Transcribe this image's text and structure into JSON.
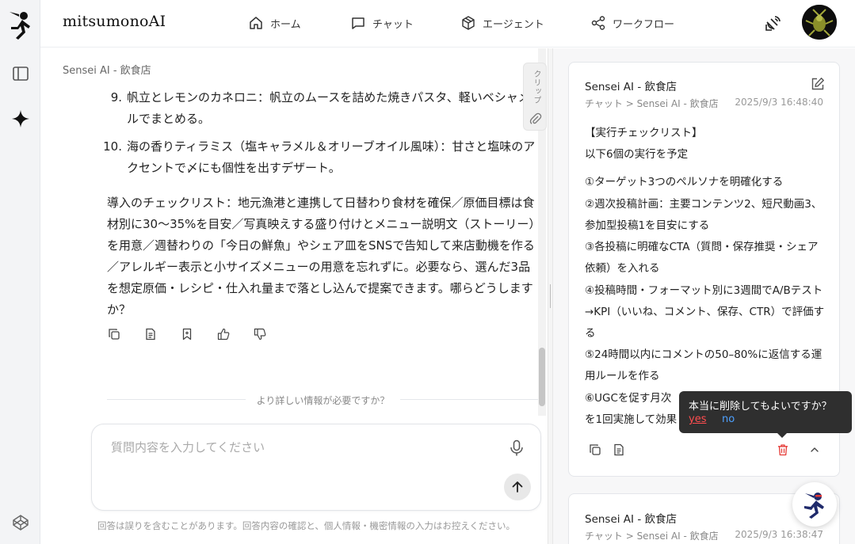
{
  "app": {
    "brand": "mitsumonoAI"
  },
  "nav": {
    "home": "ホーム",
    "chat": "チャット",
    "agent": "エージェント",
    "workflow": "ワークフロー"
  },
  "chat": {
    "breadcrumb": "Sensei AI - 飲食店",
    "list_items": [
      {
        "num": "9.",
        "text": "帆立とレモンのカネロニ：帆立のムースを詰めた焼きパスタ、軽いベシャメルでまとめる。"
      },
      {
        "num": "10.",
        "text": "海の香りティラミス（塩キャラメル＆オリーブオイル風味）：甘さと塩味のアクセントで〆にも個性を出すデザート。"
      }
    ],
    "paragraph": "導入のチェックリスト：地元漁港と連携して日替わり食材を確保／原価目標は食材別に30〜35%を目安／写真映えする盛り付けとメニュー説明文（ストーリー）を用意／週替わりの「今日の鮮魚」やシェア皿をSNSで告知して来店動機を作る／アレルギー表示と小サイズメニューの用意を忘れずに。必要なら、選んだ3品を想定原価・レシピ・仕入れ量まで落とし込んで提案できます。哪らどうしますか？",
    "divider_label": "より詳しい情報が必要ですか？",
    "input_placeholder": "質問内容を入力してください",
    "disclaimer": "回答は誤りを含むことがあります。回答内容の確認と、個人情報・機密情報の入力はお控えください。",
    "clip_label": "クリップ"
  },
  "panel": {
    "cards": [
      {
        "title": "Sensei AI - 飲食店",
        "sub": "チャット > Sensei AI - 飲食店",
        "timestamp": "2025/9/3 16:48:40",
        "lines": [
          "【実行チェックリスト】",
          "以下6個の実行を予定",
          "①ターゲット3つのペルソナを明確化する",
          "②週次投稿計画：主要コンテンツ2、短尺動画3、参加型投稿1を目安にする",
          "③各投稿に明確なCTA（質問・保存推奨・シェア依頼）を入れる",
          "④投稿時間・フォーマット別に3週間でA/Bテスト→KPI（いいね、コメント、保存、CTR）で評価する",
          "⑤24時間以内にコメントの50–80%に返信する運用ルールを作る",
          "⑥UGCを促す月次",
          "を1回実施して効果"
        ]
      },
      {
        "title": "Sensei AI - 飲食店",
        "sub": "チャット > Sensei AI - 飲食店",
        "timestamp": "2025/9/3 16:38:47"
      }
    ]
  },
  "tooltip": {
    "question": "本当に削除してもよいですか？",
    "yes": "yes",
    "no": "no"
  }
}
